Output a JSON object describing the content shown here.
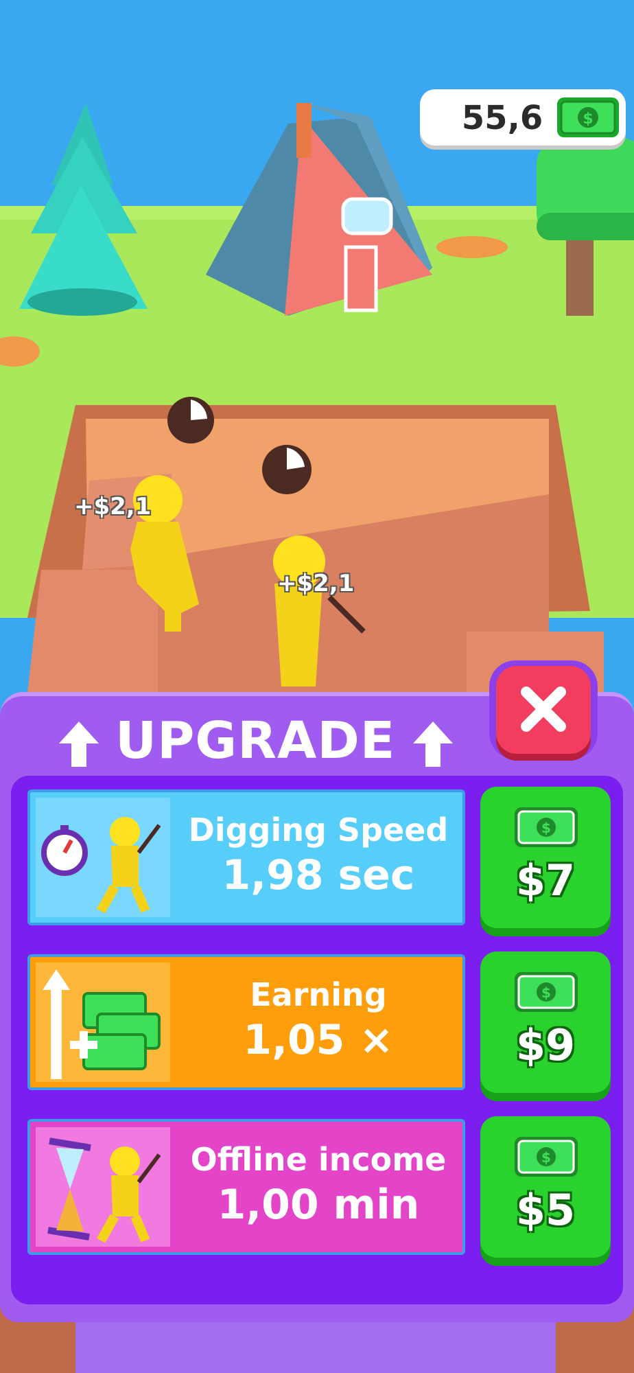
{
  "hud": {
    "money": "55,6",
    "money_icon": "cash-icon"
  },
  "floating_texts": [
    "+$2,1",
    "+$2,1"
  ],
  "panel": {
    "title": "UPGRADE",
    "close_icon": "close-icon",
    "upgrades": [
      {
        "title": "Digging Speed",
        "value": "1,98 sec",
        "price": "$7",
        "icon": "stopwatch-digger-icon",
        "color": "#57cdfa"
      },
      {
        "title": "Earning",
        "value": "1,05 ×",
        "price": "$9",
        "icon": "cash-stack-plus-icon",
        "color": "#ff9d0a"
      },
      {
        "title": "Offline income",
        "value": "1,00 min",
        "price": "$5",
        "icon": "hourglass-digger-icon",
        "color": "#e344c8"
      }
    ]
  }
}
